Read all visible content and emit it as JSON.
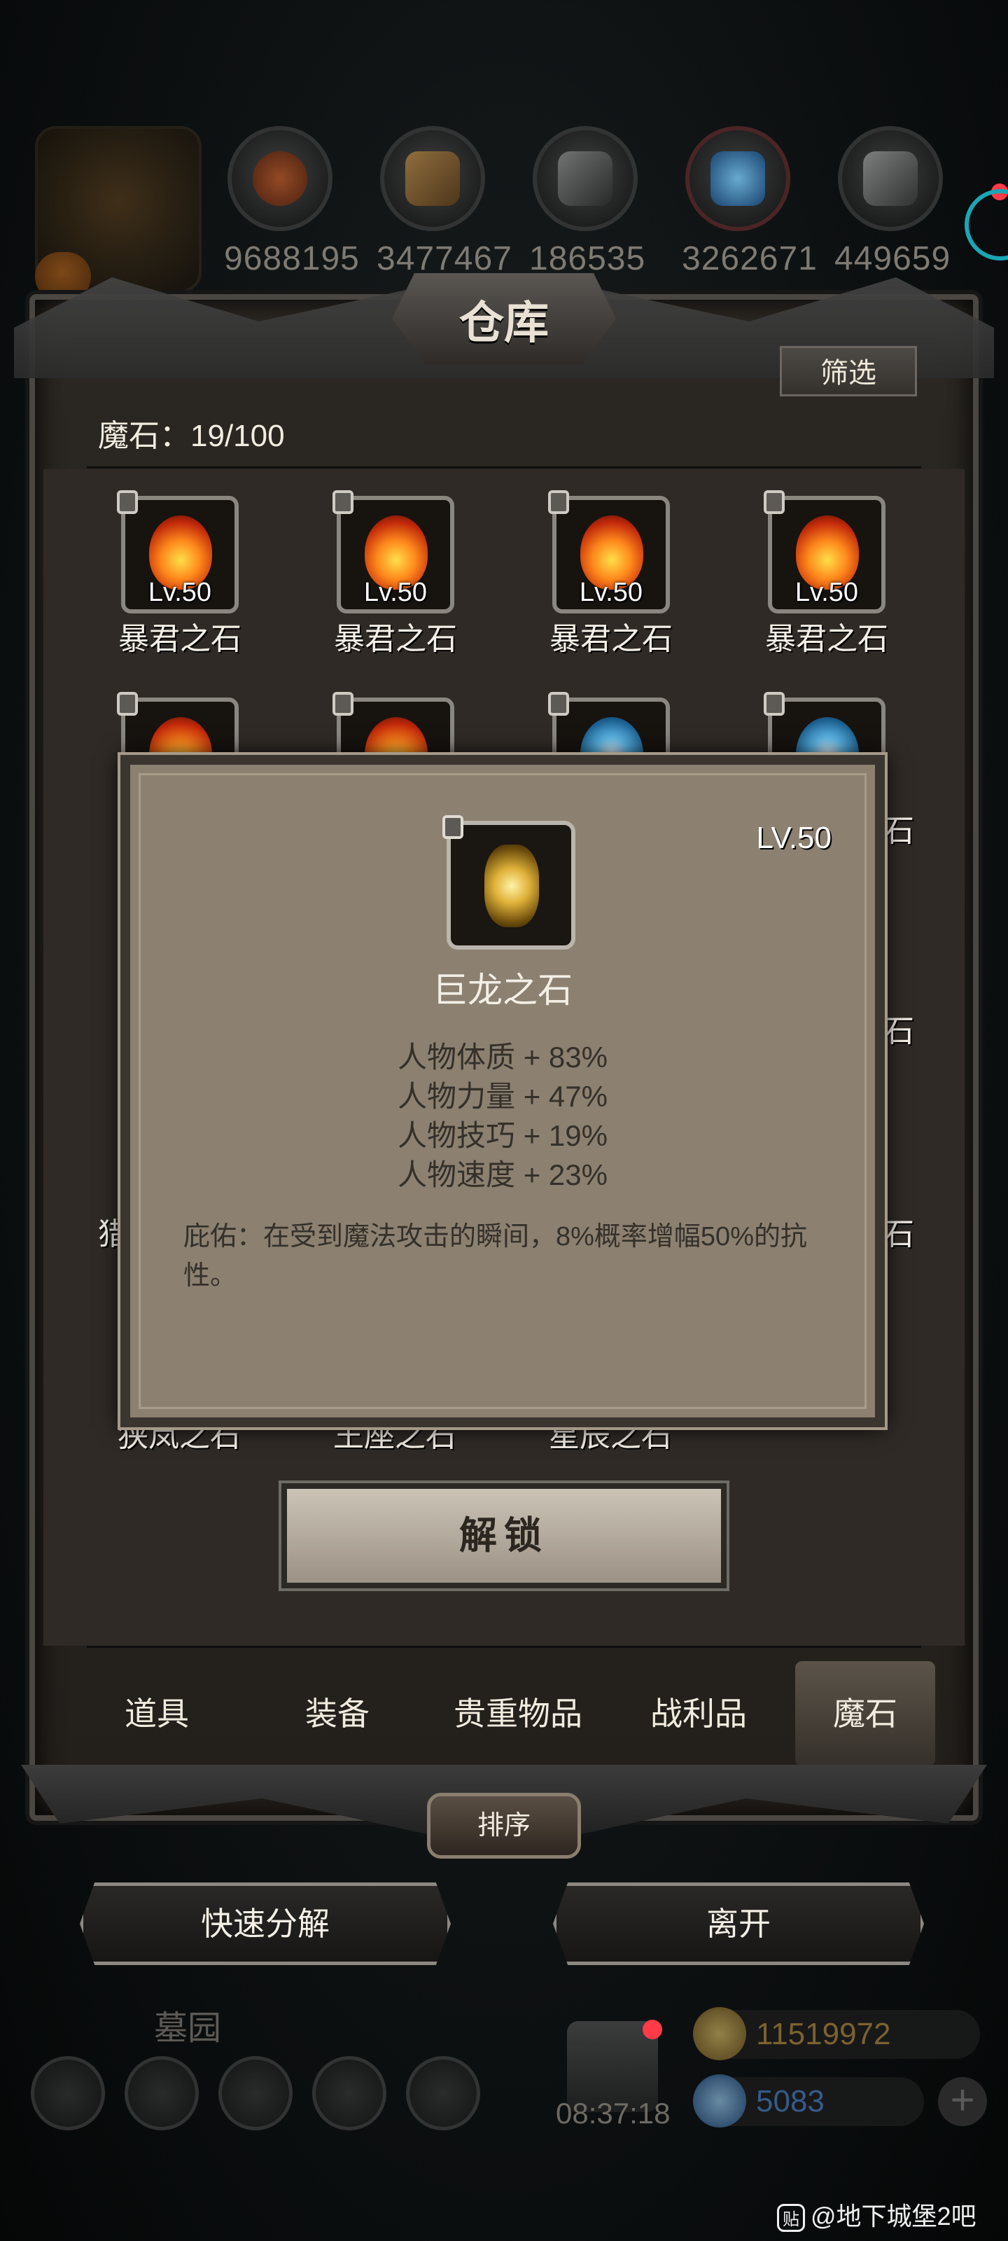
{
  "resources": [
    {
      "icon": "meat-icon",
      "value": "9688195"
    },
    {
      "icon": "wood-icon",
      "value": "3477467"
    },
    {
      "icon": "stone-icon",
      "value": "186535"
    },
    {
      "icon": "crystal-icon",
      "value": "3262671"
    },
    {
      "icon": "iron-icon",
      "value": "449659"
    }
  ],
  "panel": {
    "title": "仓库",
    "filter_label": "筛选",
    "stone_count": "魔石：19/100"
  },
  "slots": [
    {
      "name": "暴君之石",
      "level": "Lv.50",
      "gem": "fire"
    },
    {
      "name": "暴君之石",
      "level": "Lv.50",
      "gem": "fire"
    },
    {
      "name": "暴君之石",
      "level": "Lv.50",
      "gem": "fire"
    },
    {
      "name": "暴君之石",
      "level": "Lv.50",
      "gem": "fire"
    }
  ],
  "peeks": {
    "row2_right": "石",
    "row3_right": "石",
    "row4_left": "猎",
    "row4_right": "石",
    "row5_a": "狭岚之石",
    "row5_b": "王座之石",
    "row5_c": "星辰之石"
  },
  "tooltip": {
    "level": "LV.50",
    "name": "巨龙之石",
    "stats": [
      "人物体质 + 83%",
      "人物力量 + 47%",
      "人物技巧 + 19%",
      "人物速度 + 23%"
    ],
    "description": "庇佑：在受到魔法攻击的瞬间，8%概率增幅50%的抗性。"
  },
  "unlock_label": "解锁",
  "tabs": [
    {
      "label": "道具",
      "active": false
    },
    {
      "label": "装备",
      "active": false
    },
    {
      "label": "贵重物品",
      "active": false
    },
    {
      "label": "战利品",
      "active": false
    },
    {
      "label": "魔石",
      "active": true
    }
  ],
  "sort_label": "排序",
  "actions": {
    "quick_decompose": "快速分解",
    "leave": "离开"
  },
  "hud": {
    "location": "墓园",
    "timer": "08:37:18",
    "gold": "11519972",
    "gems": "5083"
  },
  "watermark": "@地下城堡2吧",
  "watermark_badge": "贴",
  "colors": {
    "accent_red": "#ff3b47",
    "panel_bg": "#2b2722",
    "tooltip_bg": "#8c8070"
  }
}
